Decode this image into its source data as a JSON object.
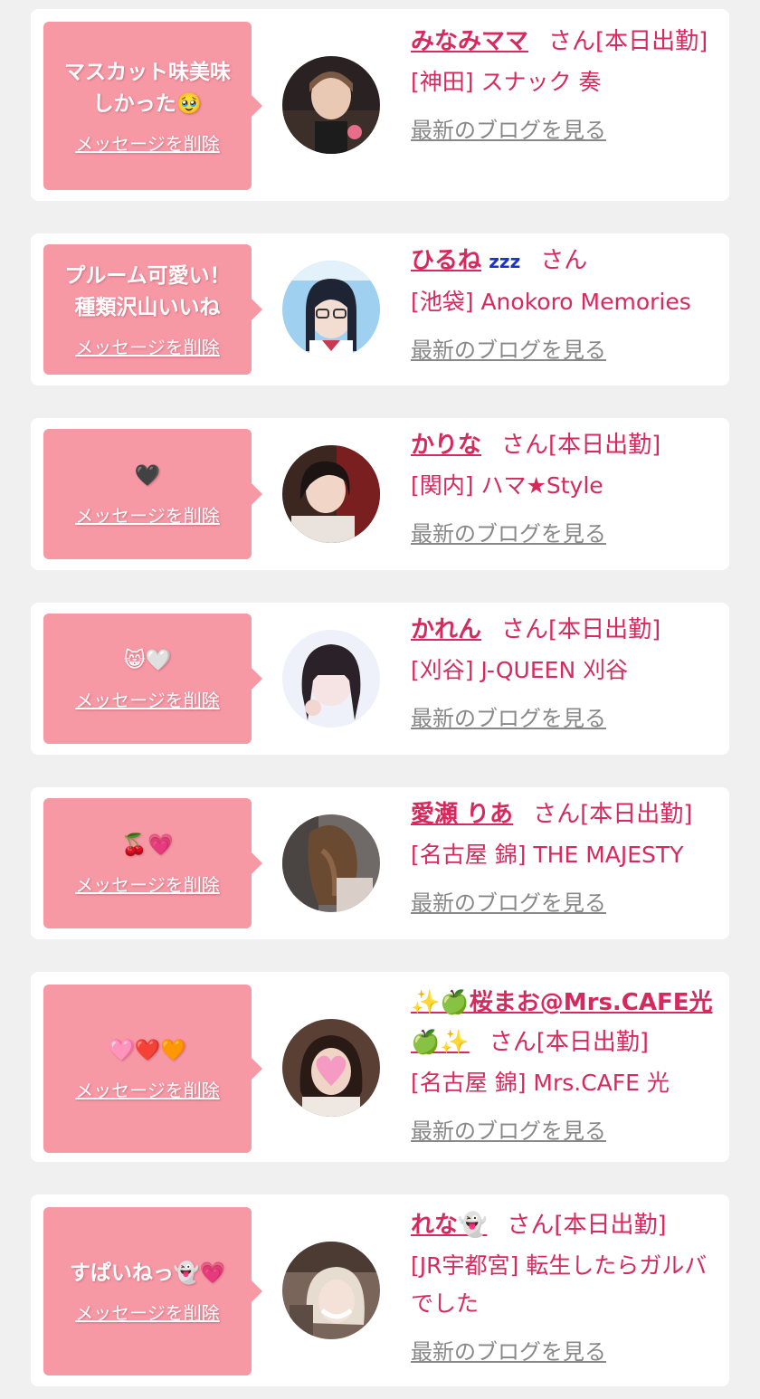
{
  "labels": {
    "delete_message": "メッセージを削除",
    "blog_link": "最新のブログを見る"
  },
  "colors": {
    "page_bg": "#f0f0f0",
    "card_bg": "#ffffff",
    "bubble_bg": "#f798a5",
    "accent": "#d62a5e",
    "link_gray": "#888888"
  },
  "items": [
    {
      "message": "マスカット味美味\nしかった🥹",
      "name": "みなみママ",
      "suffix": "さん[本日出勤]",
      "shop": "[神田] スナック 奏"
    },
    {
      "message": "プルーム可愛い！\n種類沢山いいね",
      "name": "ひるね",
      "name_icon": "zzz",
      "suffix": "さん",
      "shop": "[池袋] Anokoro Memories"
    },
    {
      "message": "🖤",
      "name": "かりな",
      "suffix": "さん[本日出勤]",
      "shop": "[関内] ハマ★Style"
    },
    {
      "message": "😸🤍",
      "name": "かれん",
      "suffix": "さん[本日出勤]",
      "shop": "[刈谷] J-QUEEN 刈谷"
    },
    {
      "message": "🍒💗",
      "name": "愛瀬 りあ",
      "suffix": "さん[本日出勤]",
      "shop": "[名古屋 錦] THE MAJESTY"
    },
    {
      "message": "🩷❤️🧡",
      "name": "✨🍏桜まお@Mrs.CAFE光🍏✨",
      "suffix": "さん[本日出勤]",
      "shop": "[名古屋 錦] Mrs.CAFE 光"
    },
    {
      "message": "すぱいねっ👻💗",
      "name": "れな👻",
      "suffix": "さん[本日出勤]",
      "shop": "[JR宇都宮] 転生したらガルバでした"
    }
  ]
}
